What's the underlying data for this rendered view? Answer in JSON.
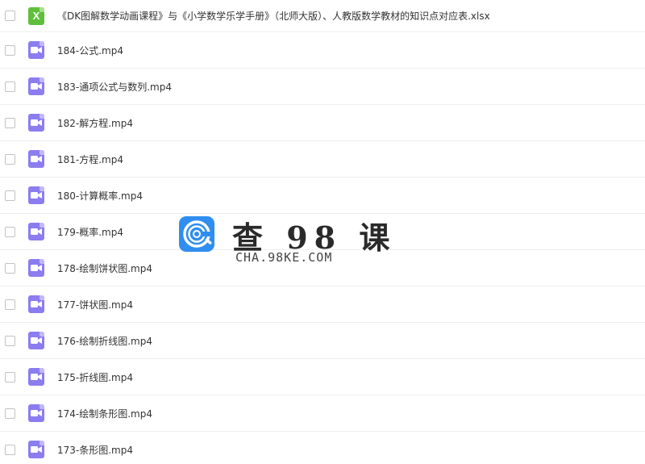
{
  "files": [
    {
      "name": "《DK图解数学动画课程》与《小学数学乐学手册》（北师大版）、人教版数学教材的知识点对应表.xlsx",
      "type": "xlsx",
      "icon": "excel-file-icon",
      "icon_letter": "X",
      "icon_color": "#5fbf3d"
    },
    {
      "name": "184-公式.mp4",
      "type": "video",
      "icon": "video-file-icon"
    },
    {
      "name": "183-通项公式与数列.mp4",
      "type": "video",
      "icon": "video-file-icon"
    },
    {
      "name": "182-解方程.mp4",
      "type": "video",
      "icon": "video-file-icon"
    },
    {
      "name": "181-方程.mp4",
      "type": "video",
      "icon": "video-file-icon"
    },
    {
      "name": "180-计算概率.mp4",
      "type": "video",
      "icon": "video-file-icon"
    },
    {
      "name": "179-概率.mp4",
      "type": "video",
      "icon": "video-file-icon"
    },
    {
      "name": "178-绘制饼状图.mp4",
      "type": "video",
      "icon": "video-file-icon"
    },
    {
      "name": "177-饼状图.mp4",
      "type": "video",
      "icon": "video-file-icon"
    },
    {
      "name": "176-绘制折线图.mp4",
      "type": "video",
      "icon": "video-file-icon"
    },
    {
      "name": "175-折线图.mp4",
      "type": "video",
      "icon": "video-file-icon"
    },
    {
      "name": "174-绘制条形图.mp4",
      "type": "video",
      "icon": "video-file-icon"
    },
    {
      "name": "173-条形图.mp4",
      "type": "video",
      "icon": "video-file-icon"
    }
  ],
  "video_icon_color": "#8b7df0",
  "watermark": {
    "title": "查 98 课",
    "subtitle": "CHA.98KE.COM",
    "logo_color": "#2f8ef0"
  }
}
